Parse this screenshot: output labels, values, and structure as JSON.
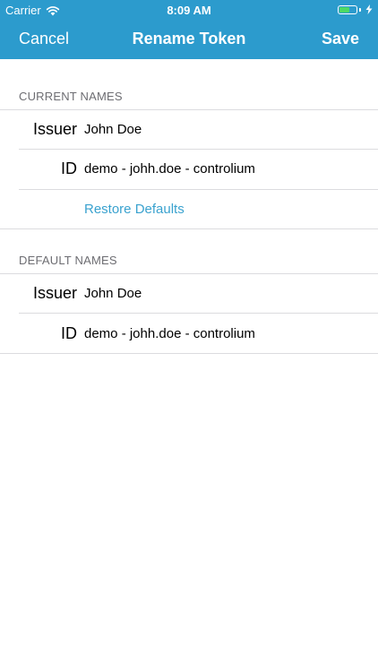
{
  "status_bar": {
    "carrier": "Carrier",
    "time": "8:09 AM",
    "battery_level": 0.6,
    "battery_color": "#4cd964"
  },
  "nav": {
    "cancel_label": "Cancel",
    "title": "Rename Token",
    "save_label": "Save",
    "background_color": "#2c9bcd"
  },
  "current_names": {
    "header": "CURRENT NAMES",
    "issuer_label": "Issuer",
    "issuer_value": "John Doe",
    "id_label": "ID",
    "id_value": "demo - johh.doe - controlium",
    "restore_label": "Restore Defaults",
    "link_color": "#3aa2cf"
  },
  "default_names": {
    "header": "DEFAULT NAMES",
    "issuer_label": "Issuer",
    "issuer_value": "John Doe",
    "id_label": "ID",
    "id_value": "demo - johh.doe - controlium"
  }
}
